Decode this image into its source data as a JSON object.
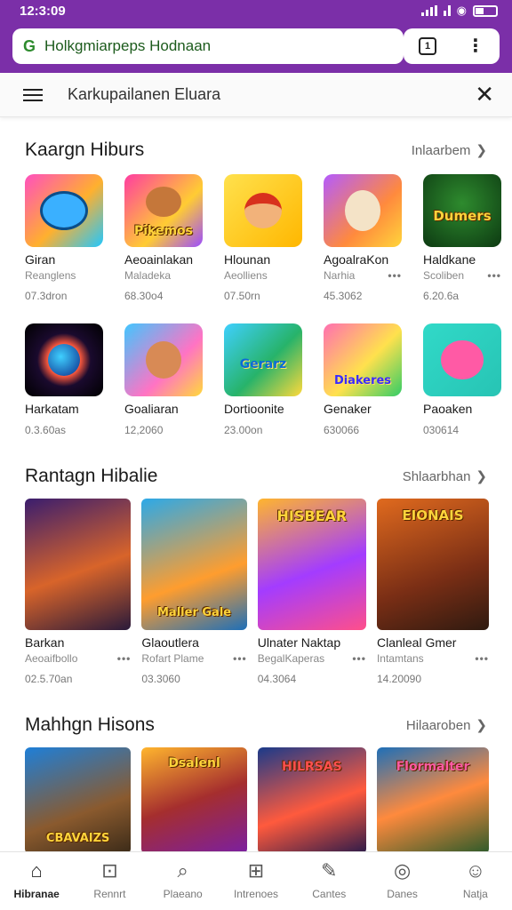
{
  "status": {
    "time": "12:3:09"
  },
  "browser": {
    "url": "Holkgmiarpeps Hodnaan",
    "tab_count": "1"
  },
  "header": {
    "title": "Karkupailanen Eluara"
  },
  "sections": [
    {
      "title": "Kaargn Hiburs",
      "see_all": "Inlaarbem",
      "rows": [
        [
          {
            "name": "Giran",
            "dev": "Reanglens",
            "meta": "07.3dron",
            "dots": ""
          },
          {
            "name": "Aeoainlakan",
            "dev": "Maladeka",
            "meta": "68.30o4",
            "dots": ""
          },
          {
            "name": "Hlounan",
            "dev": "Aeolliens",
            "meta": "07.50rn",
            "dots": ""
          },
          {
            "name": "AgoalraKon",
            "dev": "Narhia",
            "meta": "45.3062",
            "dots": "•••"
          },
          {
            "name": "Haldkane",
            "dev": "Scoliben",
            "meta": "6.20.6a",
            "dots": "•••"
          }
        ],
        [
          {
            "name": "Harkatam",
            "dev": "",
            "meta": "0.3.60as",
            "dots": ""
          },
          {
            "name": "Goaliaran",
            "dev": "",
            "meta": "12,2060",
            "dots": ""
          },
          {
            "name": "Dortioonite",
            "dev": "",
            "meta": "23.00on",
            "dots": ""
          },
          {
            "name": "Genaker",
            "dev": "",
            "meta": "630066",
            "dots": ""
          },
          {
            "name": "Paoaken",
            "dev": "",
            "meta": "030614",
            "dots": ""
          }
        ]
      ]
    },
    {
      "title": "Rantagn Hibalie",
      "see_all": "Shlaarbhan",
      "cards": [
        {
          "name": "Barkan",
          "dev": "Aeoaifbollo",
          "meta": "02.5.70an",
          "dots": "•••"
        },
        {
          "name": "Glaoutlera",
          "dev": "Rofart Plame",
          "meta": "03.3060",
          "dots": "•••"
        },
        {
          "name": "Ulnater Naktap",
          "dev": "BegalKaperas",
          "meta": "04.3064",
          "dots": "•••"
        },
        {
          "name": "Clanleal Gmer",
          "dev": "Intamtans",
          "meta": "14.20090",
          "dots": "•••"
        }
      ]
    },
    {
      "title": "Mahhgn Hisons",
      "see_all": "Hilaaroben",
      "cards": [
        {
          "art": "CBAVAIZS"
        },
        {
          "art": "Dsalenl"
        },
        {
          "art": "HILRSAS"
        },
        {
          "art": "Flormalter"
        }
      ]
    }
  ],
  "art_labels": {
    "row1": [
      "",
      "Pikemos",
      "",
      "",
      "Dumers"
    ],
    "row2": [
      "",
      "",
      "Gerarz",
      "Diakeres",
      ""
    ],
    "wide": [
      "",
      "Maller Gale",
      "HISBEAR",
      "EIONAIS"
    ]
  },
  "nav": [
    {
      "label": "Hibranae",
      "icon": "home-icon"
    },
    {
      "label": "Rennrt",
      "icon": "store-icon"
    },
    {
      "label": "Plaeano",
      "icon": "search-icon"
    },
    {
      "label": "Intrenoes",
      "icon": "apps-icon"
    },
    {
      "label": "Cantes",
      "icon": "edit-icon"
    },
    {
      "label": "Danes",
      "icon": "compass-icon"
    },
    {
      "label": "Natja",
      "icon": "profile-icon"
    }
  ],
  "colors": {
    "brand": "#7b2fa8",
    "link": "#2e8b2e"
  }
}
